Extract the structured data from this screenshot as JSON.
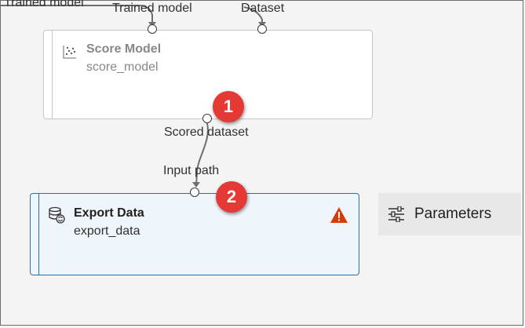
{
  "top_edge": {
    "source_label": "Trained model"
  },
  "score_model": {
    "title": "Score Model",
    "subtitle": "score_model",
    "inputs": [
      {
        "label": "Trained model"
      },
      {
        "label": "Dataset"
      }
    ],
    "output": {
      "label": "Scored dataset"
    },
    "icon": "scatter-plot-icon"
  },
  "export_data": {
    "title": "Export Data",
    "subtitle": "export_data",
    "input": {
      "label": "Input path"
    },
    "icon": "database-sync-icon",
    "status_icon": "warning-icon",
    "status_color": "#d83b01"
  },
  "markers": [
    {
      "label": "1"
    },
    {
      "label": "2"
    }
  ],
  "parameters_panel": {
    "label": "Parameters",
    "icon": "sliders-icon"
  },
  "colors": {
    "canvas": "#f4f4f4",
    "selected_border": "#2f6ea8",
    "selected_fill": "#eef5fb",
    "marker": "#e53935"
  }
}
